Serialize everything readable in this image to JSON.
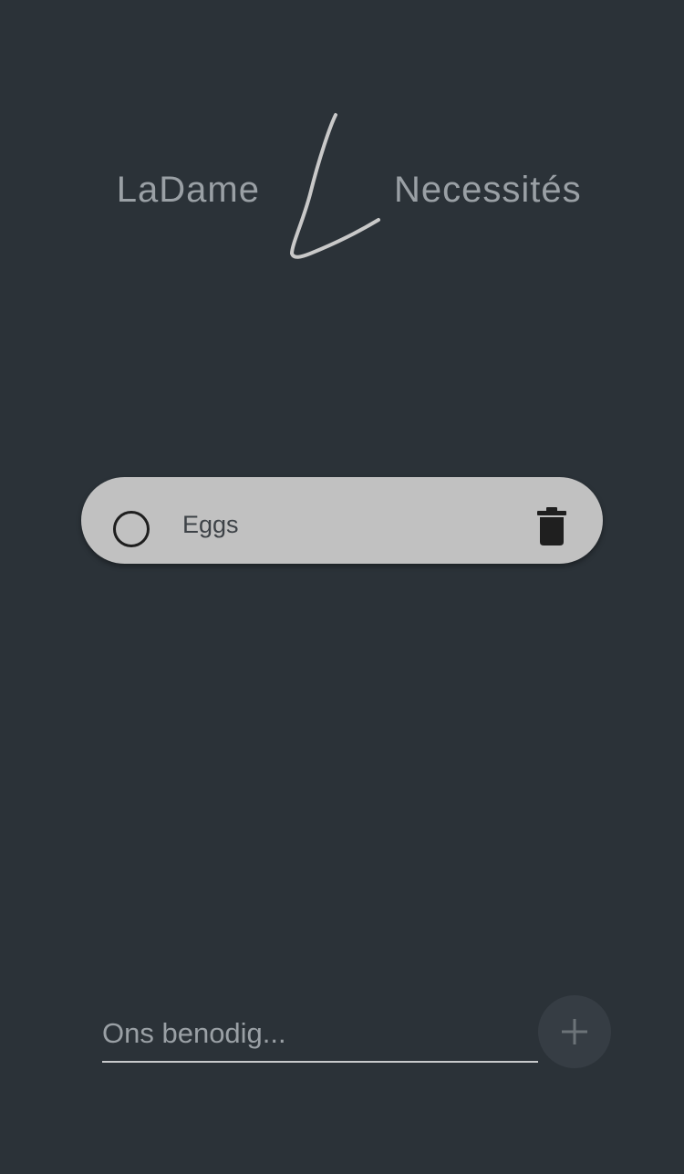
{
  "header": {
    "brand_left": "LaDame",
    "brand_right": "Necessités",
    "logo_icon": "handwritten-l-logo"
  },
  "list": {
    "items": [
      {
        "label": "Eggs",
        "checked": false,
        "check_icon": "circle-outline-icon",
        "delete_icon": "trash-icon"
      }
    ]
  },
  "composer": {
    "placeholder": "Ons benodig...",
    "value": "",
    "add_icon": "plus-icon"
  },
  "colors": {
    "background": "#2b3238",
    "card": "#c1c1c1",
    "text_muted": "#9aa0a5"
  }
}
